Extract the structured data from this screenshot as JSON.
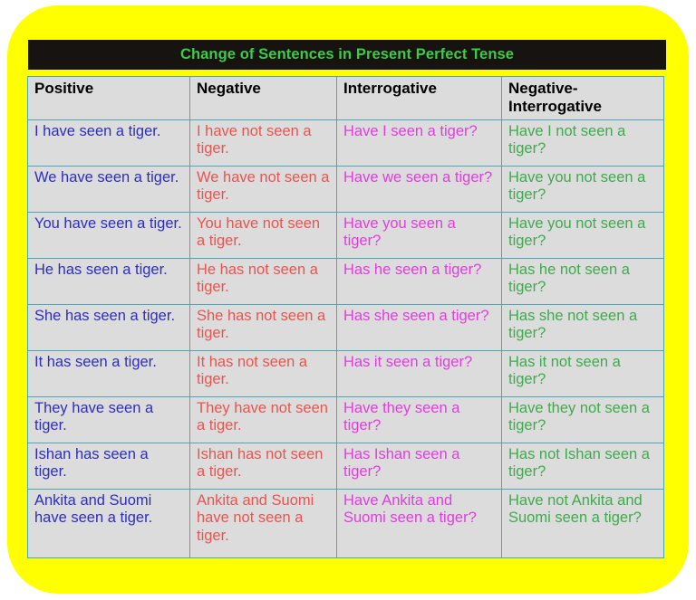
{
  "title": "Change of Sentences in Present Perfect Tense",
  "colors": {
    "card_background": "#ffff00",
    "title_bar_background": "#161310",
    "title_text": "#3ecb46",
    "cell_background": "#dcdcdc",
    "cell_border": "#4aa6b8",
    "header_text": "#000000",
    "positive_text": "#2e2ebe",
    "negative_text": "#e9544f",
    "interrogative_text": "#e23ce0",
    "negative_interrogative_text": "#3faa4e"
  },
  "table": {
    "headers": [
      "Positive",
      "Negative",
      "Interrogative",
      "Negative-Interrogative"
    ],
    "rows": [
      {
        "positive": "I have seen a tiger.",
        "negative": "I have not seen a tiger.",
        "interrogative": "Have I seen a tiger?",
        "negative_interrogative": "Have I not seen a tiger?"
      },
      {
        "positive": "We have seen a tiger.",
        "negative": "We have not seen a tiger.",
        "interrogative": "Have we seen a tiger?",
        "negative_interrogative": "Have you  not seen a tiger?"
      },
      {
        "positive": "You have seen a tiger.",
        "negative": "You have not seen a tiger.",
        "interrogative": "Have you seen a tiger?",
        "negative_interrogative": "Have you not seen a tiger?"
      },
      {
        "positive": "He has seen a tiger.",
        "negative": "He has not seen a tiger.",
        "interrogative": "Has he seen a tiger?",
        "negative_interrogative": "Has he not seen a tiger?"
      },
      {
        "positive": "She has seen a tiger.",
        "negative": "She has not seen a tiger.",
        "interrogative": "Has she seen a tiger?",
        "negative_interrogative": "Has she not seen a tiger?"
      },
      {
        "positive": "It has seen a tiger.",
        "negative": "It has not seen a tiger.",
        "interrogative": "Has it seen a tiger?",
        "negative_interrogative": "Has it not seen a tiger?"
      },
      {
        "positive": "They have seen a tiger.",
        "negative": "They have not seen a tiger.",
        "interrogative": "Have they seen a tiger?",
        "negative_interrogative": "Have they not seen a tiger?"
      },
      {
        "positive": "Ishan has seen a tiger.",
        "negative": "Ishan has not seen a tiger.",
        "interrogative": "Has Ishan seen a tiger?",
        "negative_interrogative": "Has not Ishan seen a tiger?"
      },
      {
        "positive": "Ankita and Suomi have seen a tiger.",
        "negative": "Ankita and Suomi have not seen a tiger.",
        "interrogative": "Have Ankita and Suomi seen a tiger?",
        "negative_interrogative": "Have not Ankita and Suomi seen a tiger?"
      }
    ]
  }
}
